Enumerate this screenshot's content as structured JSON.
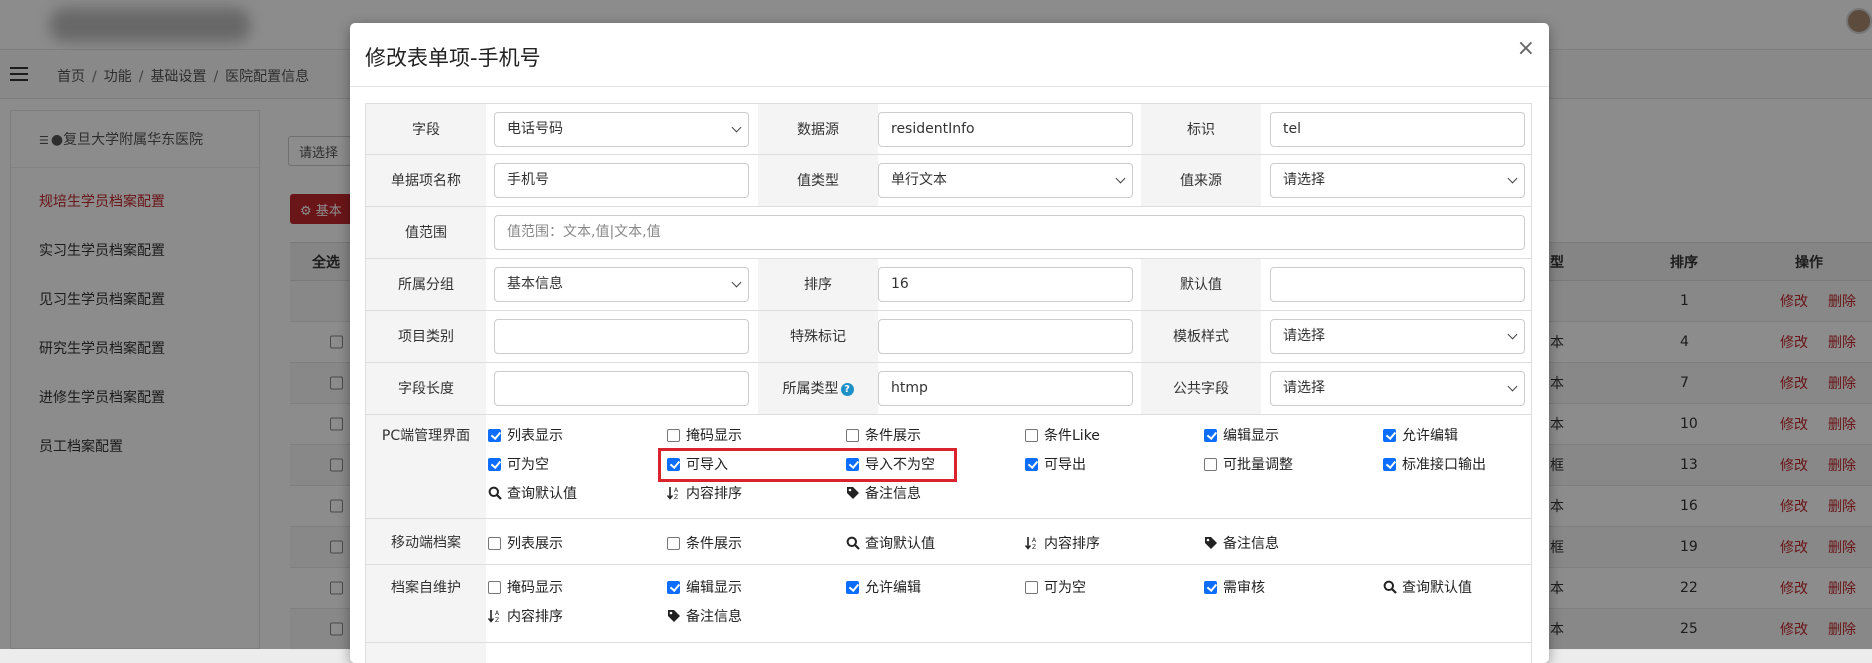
{
  "breadcrumb": {
    "items": [
      "首页",
      "功能",
      "基础设置",
      "医院配置信息"
    ]
  },
  "sidebar": {
    "hospital": "●复旦大学附属华东医院",
    "items": [
      {
        "label": "规培生学员档案配置",
        "active": true
      },
      {
        "label": "实习生学员档案配置",
        "active": false
      },
      {
        "label": "见习生学员档案配置",
        "active": false
      },
      {
        "label": "研究生学员档案配置",
        "active": false
      },
      {
        "label": "进修生学员档案配置",
        "active": false
      },
      {
        "label": "员工档案配置",
        "active": false
      }
    ]
  },
  "background": {
    "select_label": "请选择",
    "red_button": "基本",
    "table": {
      "headers": {
        "select_all": "全选",
        "type": "型",
        "order": "排序",
        "actions": "操作"
      },
      "rows": [
        {
          "type": "",
          "order": "1"
        },
        {
          "type": "本",
          "order": "4"
        },
        {
          "type": "本",
          "order": "7"
        },
        {
          "type": "本",
          "order": "10"
        },
        {
          "type": "框",
          "order": "13"
        },
        {
          "type": "本",
          "order": "16"
        },
        {
          "type": "框",
          "order": "19"
        },
        {
          "type": "本",
          "order": "22"
        },
        {
          "type": "本",
          "order": "25"
        }
      ],
      "edit_label": "修改",
      "delete_label": "删除"
    }
  },
  "modal": {
    "title": "修改表单项-手机号",
    "close": "×",
    "fields": {
      "field": {
        "label": "字段",
        "value": "电话号码"
      },
      "datasource": {
        "label": "数据源",
        "value": "residentInfo"
      },
      "identifier": {
        "label": "标识",
        "value": "tel"
      },
      "item_name": {
        "label": "单据项名称",
        "value": "手机号"
      },
      "value_type": {
        "label": "值类型",
        "value": "单行文本"
      },
      "value_source": {
        "label": "值来源",
        "value": "请选择"
      },
      "value_range": {
        "label": "值范围",
        "placeholder": "值范围：文本,值|文本,值"
      },
      "group": {
        "label": "所属分组",
        "value": "基本信息"
      },
      "order": {
        "label": "排序",
        "value": "16"
      },
      "default_value": {
        "label": "默认值",
        "value": ""
      },
      "item_category": {
        "label": "项目类别",
        "value": ""
      },
      "special_mark": {
        "label": "特殊标记",
        "value": ""
      },
      "template_style": {
        "label": "模板样式",
        "value": "请选择"
      },
      "field_length": {
        "label": "字段长度",
        "value": ""
      },
      "belong_type": {
        "label": "所属类型",
        "value": "htmp"
      },
      "public_field": {
        "label": "公共字段",
        "value": "请选择"
      }
    },
    "pc": {
      "label": "PC端管理界面",
      "checks": [
        {
          "label": "列表显示",
          "checked": true
        },
        {
          "label": "掩码显示",
          "checked": false
        },
        {
          "label": "条件展示",
          "checked": false
        },
        {
          "label": "条件Like",
          "checked": false
        },
        {
          "label": "编辑显示",
          "checked": true
        },
        {
          "label": "允许编辑",
          "checked": true
        },
        {
          "label": "可为空",
          "checked": true
        },
        {
          "label": "可导入",
          "checked": true
        },
        {
          "label": "导入不为空",
          "checked": true
        },
        {
          "label": "可导出",
          "checked": true
        },
        {
          "label": "可批量调整",
          "checked": false
        },
        {
          "label": "标准接口输出",
          "checked": true
        }
      ],
      "links": [
        "查询默认值",
        "内容排序",
        "备注信息"
      ]
    },
    "mobile": {
      "label": "移动端档案",
      "checks": [
        {
          "label": "列表展示",
          "checked": false
        },
        {
          "label": "条件展示",
          "checked": false
        }
      ],
      "links": [
        "查询默认值",
        "内容排序",
        "备注信息"
      ]
    },
    "self": {
      "label": "档案自维护",
      "checks": [
        {
          "label": "掩码显示",
          "checked": false
        },
        {
          "label": "编辑显示",
          "checked": true
        },
        {
          "label": "允许编辑",
          "checked": true
        },
        {
          "label": "可为空",
          "checked": false
        },
        {
          "label": "需审核",
          "checked": true
        }
      ],
      "links": [
        "查询默认值",
        "内容排序",
        "备注信息"
      ]
    }
  }
}
